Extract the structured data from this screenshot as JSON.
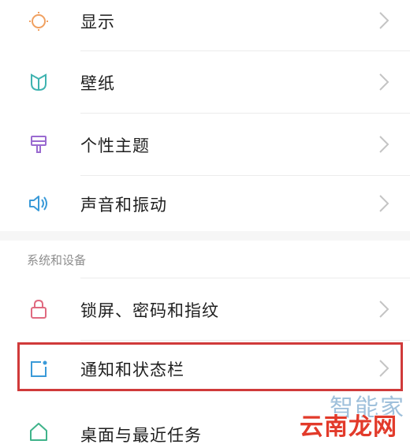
{
  "settings": {
    "items": [
      {
        "label": "显示",
        "icon": "brightness-icon"
      },
      {
        "label": "壁纸",
        "icon": "wallpaper-icon"
      },
      {
        "label": "个性主题",
        "icon": "theme-brush-icon"
      },
      {
        "label": "声音和振动",
        "icon": "speaker-icon"
      }
    ],
    "section_title": "系统和设备",
    "system_items": [
      {
        "label": "锁屏、密码和指纹",
        "icon": "lock-icon"
      },
      {
        "label": "通知和状态栏",
        "icon": "notification-icon"
      },
      {
        "label": "桌面与最近任务",
        "icon": "home-icon"
      }
    ]
  },
  "watermark": {
    "top": "智能家",
    "bottom": "云南龙网"
  },
  "colors": {
    "highlight": "#d03a3a",
    "brightness": "#f0a060",
    "wallpaper": "#3fb3b0",
    "theme": "#9a6ad0",
    "speaker": "#3a9ad8",
    "lock": "#e06a80",
    "notification": "#3a9ad8",
    "home": "#3fb38a"
  }
}
